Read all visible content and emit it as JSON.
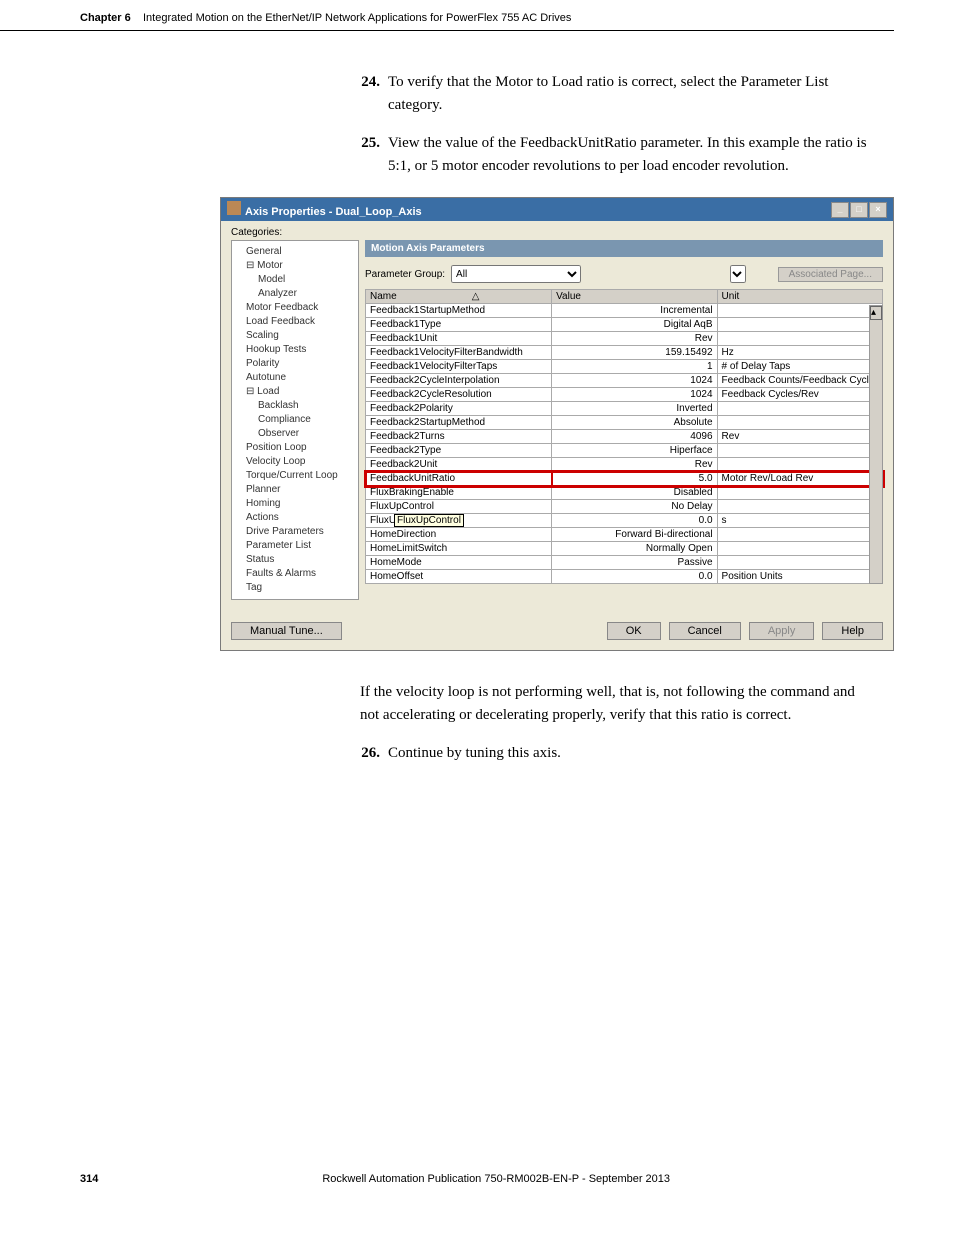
{
  "header": {
    "chapter": "Chapter 6",
    "title": "Integrated Motion on the EtherNet/IP Network Applications for PowerFlex 755 AC Drives"
  },
  "steps": {
    "s24_num": "24.",
    "s24": "To verify that the Motor to Load ratio is correct, select the Parameter List category.",
    "s25_num": "25.",
    "s25": "View the value of the FeedbackUnitRatio parameter. In this example the ratio is 5:1, or 5 motor encoder revolutions to per load encoder revolution.",
    "post1": "If the velocity loop is not performing well, that is, not following the command and not accelerating or decelerating properly, verify that this ratio is correct.",
    "s26_num": "26.",
    "s26": "Continue by tuning this axis."
  },
  "dialog": {
    "title": "Axis Properties - Dual_Loop_Axis",
    "categories_label": "Categories:",
    "panel_title": "Motion Axis Parameters",
    "param_group_label": "Parameter Group:",
    "param_group_value": "All",
    "assoc_page": "Associated Page...",
    "tooltip": "FluxUpControl",
    "manual_tune": "Manual Tune...",
    "ok": "OK",
    "cancel": "Cancel",
    "apply": "Apply",
    "help": "Help",
    "min": "_",
    "max": "□",
    "close": "×"
  },
  "tree": [
    "General",
    "Motor",
    "Model",
    "Analyzer",
    "Motor Feedback",
    "Load Feedback",
    "Scaling",
    "Hookup Tests",
    "Polarity",
    "Autotune",
    "Load",
    "Backlash",
    "Compliance",
    "Observer",
    "Position Loop",
    "Velocity Loop",
    "Torque/Current Loop",
    "Planner",
    "Homing",
    "Actions",
    "Drive Parameters",
    "Parameter List",
    "Status",
    "Faults & Alarms",
    "Tag"
  ],
  "grid": {
    "headers": {
      "name": "Name",
      "sort": "△",
      "value": "Value",
      "unit": "Unit"
    },
    "rows": [
      {
        "name": "Feedback1StartupMethod",
        "value": "Incremental",
        "unit": ""
      },
      {
        "name": "Feedback1Type",
        "value": "Digital AqB",
        "unit": ""
      },
      {
        "name": "Feedback1Unit",
        "value": "Rev",
        "unit": ""
      },
      {
        "name": "Feedback1VelocityFilterBandwidth",
        "value": "159.15492",
        "unit": "Hz"
      },
      {
        "name": "Feedback1VelocityFilterTaps",
        "value": "1",
        "unit": "# of Delay Taps"
      },
      {
        "name": "Feedback2CycleInterpolation",
        "value": "1024",
        "unit": "Feedback Counts/Feedback Cycle"
      },
      {
        "name": "Feedback2CycleResolution",
        "value": "1024",
        "unit": "Feedback Cycles/Rev"
      },
      {
        "name": "Feedback2Polarity",
        "value": "Inverted",
        "unit": ""
      },
      {
        "name": "Feedback2StartupMethod",
        "value": "Absolute",
        "unit": ""
      },
      {
        "name": "Feedback2Turns",
        "value": "4096",
        "unit": "Rev"
      },
      {
        "name": "Feedback2Type",
        "value": "Hiperface",
        "unit": ""
      },
      {
        "name": "Feedback2Unit",
        "value": "Rev",
        "unit": ""
      },
      {
        "name": "FeedbackUnitRatio",
        "value": "5.0",
        "unit": "Motor Rev/Load Rev"
      },
      {
        "name": "FluxBrakingEnable",
        "value": "Disabled",
        "unit": ""
      },
      {
        "name": "FluxUpControl",
        "value": "No Delay",
        "unit": ""
      },
      {
        "name": "FluxUpTime",
        "value": "0.0",
        "unit": "s"
      },
      {
        "name": "HomeDirection",
        "value": "Forward Bi-directional",
        "unit": ""
      },
      {
        "name": "HomeLimitSwitch",
        "value": "Normally Open",
        "unit": ""
      },
      {
        "name": "HomeMode",
        "value": "Passive",
        "unit": ""
      },
      {
        "name": "HomeOffset",
        "value": "0.0",
        "unit": "Position Units"
      }
    ]
  },
  "footer": {
    "page": "314",
    "pub": "Rockwell Automation Publication 750-RM002B-EN-P - September 2013"
  }
}
